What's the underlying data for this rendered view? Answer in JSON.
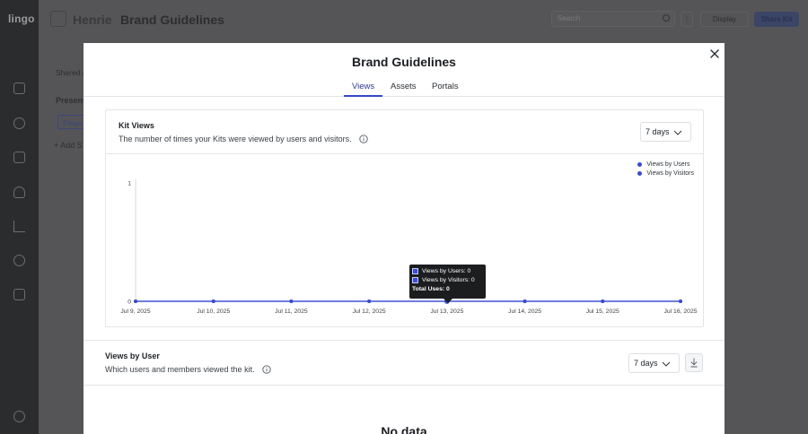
{
  "app": {
    "logo": "lingo",
    "background_title": "Brand Guidelines",
    "background_breadcrumb": "Henrie",
    "search_placeholder": "Search",
    "display_label": "Display",
    "share_label": "Share Kit",
    "sidebar_section": "Shared al",
    "present_label": "Present",
    "elegant_label": "Elega",
    "add_label": "+ Add S"
  },
  "modal": {
    "title": "Brand Guidelines",
    "tabs": [
      {
        "label": "Views",
        "active": true
      },
      {
        "label": "Assets",
        "active": false
      },
      {
        "label": "Portals",
        "active": false
      }
    ]
  },
  "kit_views": {
    "title": "Kit Views",
    "subtitle": "The number of times your Kits were viewed by users and visitors.",
    "range": "7 days"
  },
  "chart_data": {
    "type": "line",
    "x": [
      "Jul 9, 2025",
      "Jul 10, 2025",
      "Jul 11, 2025",
      "Jul 12, 2025",
      "Jul 13, 2025",
      "Jul 14, 2025",
      "Jul 15, 2025",
      "Jul 16, 2025"
    ],
    "series": [
      {
        "name": "Views by Users",
        "values": [
          0,
          0,
          0,
          0,
          0,
          0,
          0,
          0
        ],
        "color": "#3a4bd0"
      },
      {
        "name": "Views by Visitors",
        "values": [
          0,
          0,
          0,
          0,
          0,
          0,
          0,
          0
        ],
        "color": "#3a4bd0"
      }
    ],
    "yticks": [
      "0",
      "1"
    ],
    "ylim": [
      0,
      1
    ],
    "legend": "top-right",
    "grid": false,
    "tooltip": {
      "x": "Jul 13, 2025",
      "lines": [
        "Views by Users: 0",
        "Views by Visitors: 0"
      ],
      "total": "Total Uses: 0"
    }
  },
  "views_by_user": {
    "title": "Views by User",
    "subtitle": "Which users and members viewed the kit.",
    "range": "7 days",
    "empty": "No data"
  }
}
